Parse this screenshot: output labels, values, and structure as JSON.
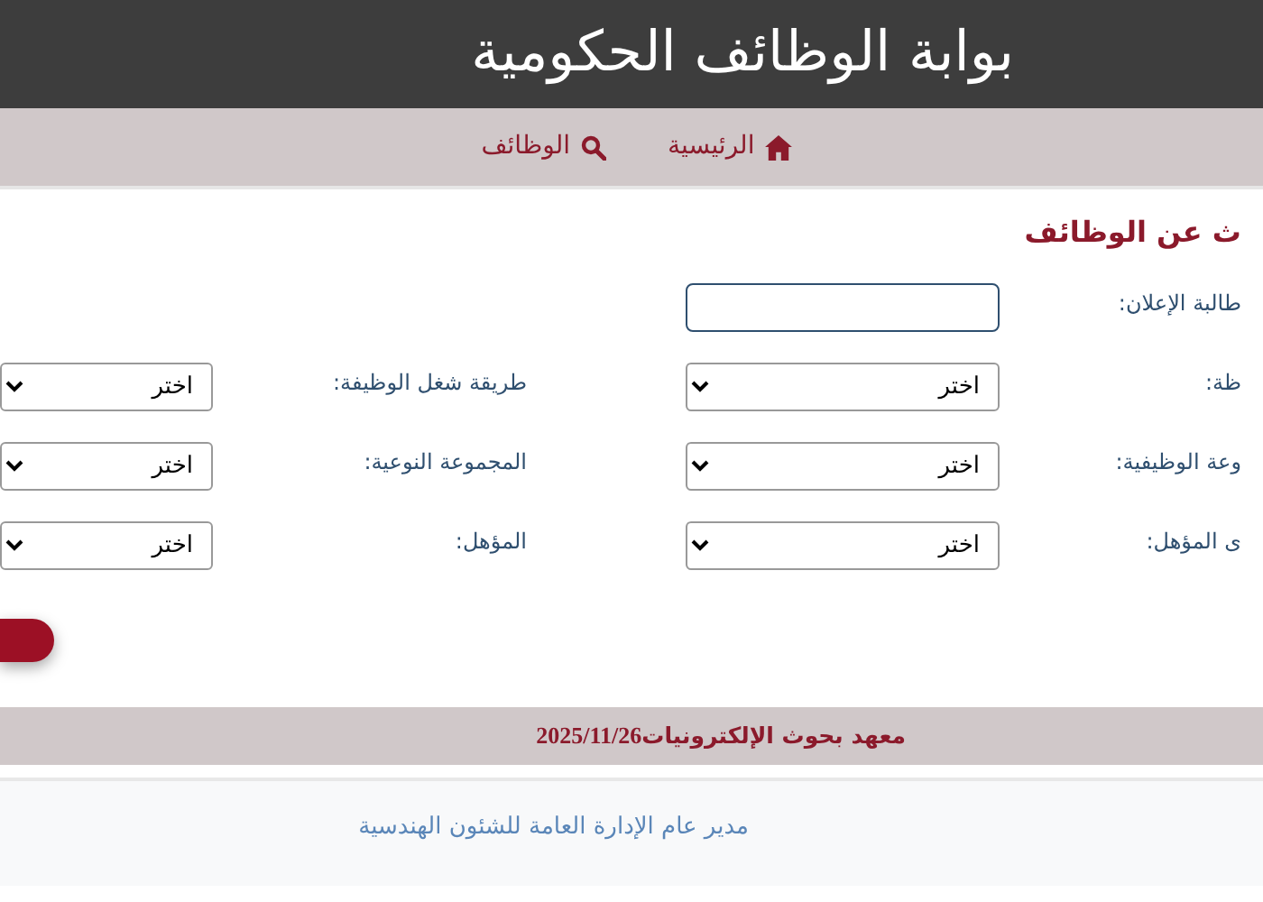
{
  "header": {
    "title": "بوابة الوظائف الحكومية"
  },
  "nav": [
    {
      "kind": "home",
      "label": "الرئيسية"
    },
    {
      "kind": "search",
      "label": "الوظائف"
    }
  ],
  "form": {
    "heading": "ث عن الوظائف",
    "rows": [
      {
        "right": {
          "label": "طالبة الإعلان:",
          "kind": "text"
        }
      },
      {
        "right": {
          "label": "ظة:",
          "kind": "select",
          "value": "اختر"
        },
        "left": {
          "label": "طريقة شغل الوظيفة:",
          "kind": "select",
          "value": "اختر"
        }
      },
      {
        "right": {
          "label": "وعة الوظيفية:",
          "kind": "select",
          "value": "اختر"
        },
        "left": {
          "label": "المجموعة النوعية:",
          "kind": "select",
          "value": "اختر"
        }
      },
      {
        "right": {
          "label": "ى المؤهل:",
          "kind": "select",
          "value": "اختر"
        },
        "left": {
          "label": "المؤهل:",
          "kind": "select",
          "value": "اختر"
        }
      }
    ]
  },
  "footer_bar": {
    "institute": "معهد بحوث الإلكترونيات",
    "date": "2025/11/26"
  },
  "signature": "مدير عام الإدارة العامة للشئون الهندسية"
}
